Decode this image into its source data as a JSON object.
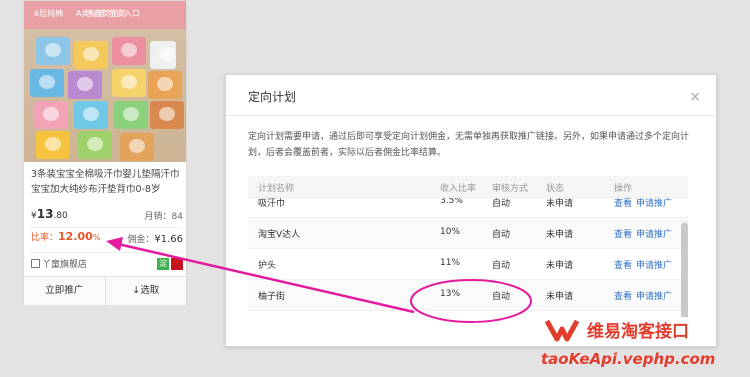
{
  "product": {
    "banner_left": "6层纯棉",
    "banner_right": "不含荧光剂",
    "banner_sub": "A类标准 可以入口",
    "title": "3条装宝宝全棉吸汗巾婴儿垫隔汗巾宝宝加大纯纱布汗垫背巾0-8岁",
    "price_symbol": "¥",
    "price_int": "13",
    "price_dec": ".80",
    "monthly_sales": "月销：84",
    "rate_label": "比率：",
    "rate_value": "12.00",
    "rate_pct": "%",
    "commission_label": "佣金：",
    "commission_value": "¥1.66",
    "shop_name": "丫童旗舰店",
    "tmall_badge": "淀",
    "btn_promote": "立即推广",
    "btn_select": "↓选取"
  },
  "modal": {
    "title": "定向计划",
    "close": "×",
    "description": "定向计划需要申请，通过后即可享受定向计划佣金，无需单独再获取推广链接。另外，如果申请通过多个定向计划，后者会覆盖前者，实际以后者佣金比率结算。",
    "headers": [
      "计划名称",
      "收入比率",
      "审核方式",
      "状态",
      "操作"
    ],
    "rows": [
      {
        "name": "吸汗巾",
        "rate": "3.5%",
        "review": "自动",
        "status": "未申请",
        "view": "查看",
        "apply": "申请推广"
      },
      {
        "name": "淘宝V达人",
        "rate": "10%",
        "review": "自动",
        "status": "未申请",
        "view": "查看",
        "apply": "申请推广"
      },
      {
        "name": "护头",
        "rate": "11%",
        "review": "自动",
        "status": "未申请",
        "view": "查看",
        "apply": "申请推广"
      },
      {
        "name": "柚子街",
        "rate": "13%",
        "review": "自动",
        "status": "未申请",
        "view": "查看",
        "apply": "申请推广"
      }
    ]
  },
  "watermark": {
    "title": "维易淘客接口",
    "url": "taoKeApi.vephp.com"
  },
  "colors": {
    "accent_red": "#e5562c",
    "link_blue": "#2f6fc4",
    "annotation_magenta": "#e5199d"
  }
}
